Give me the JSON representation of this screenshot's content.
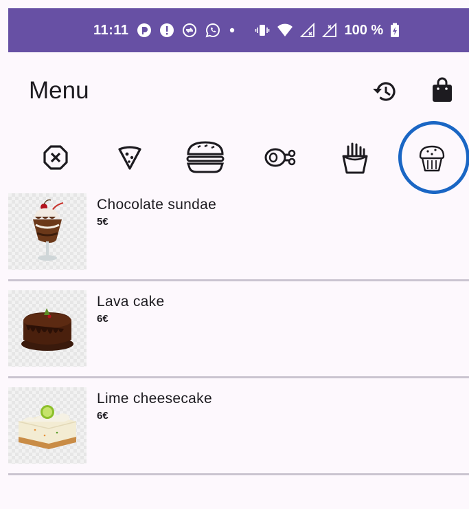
{
  "status_bar": {
    "time": "11:11",
    "battery": "100 %"
  },
  "header": {
    "title": "Menu",
    "history_icon": "history-icon",
    "cart_icon": "shopping-bag-icon"
  },
  "categories": [
    {
      "icon": "cancel-icon",
      "selected": false
    },
    {
      "icon": "pizza-icon",
      "selected": false
    },
    {
      "icon": "burger-icon",
      "selected": false
    },
    {
      "icon": "meat-icon",
      "selected": false
    },
    {
      "icon": "fries-icon",
      "selected": false
    },
    {
      "icon": "cupcake-icon",
      "selected": true
    }
  ],
  "items": [
    {
      "name": "Chocolate sundae",
      "price": "5€"
    },
    {
      "name": "Lava cake",
      "price": "6€"
    },
    {
      "name": "Lime cheesecake",
      "price": "6€"
    }
  ],
  "colors": {
    "status_bar": "#6750a4",
    "background": "#fdf8fd",
    "annotation": "#1a66c4",
    "divider": "#cac4d0"
  }
}
